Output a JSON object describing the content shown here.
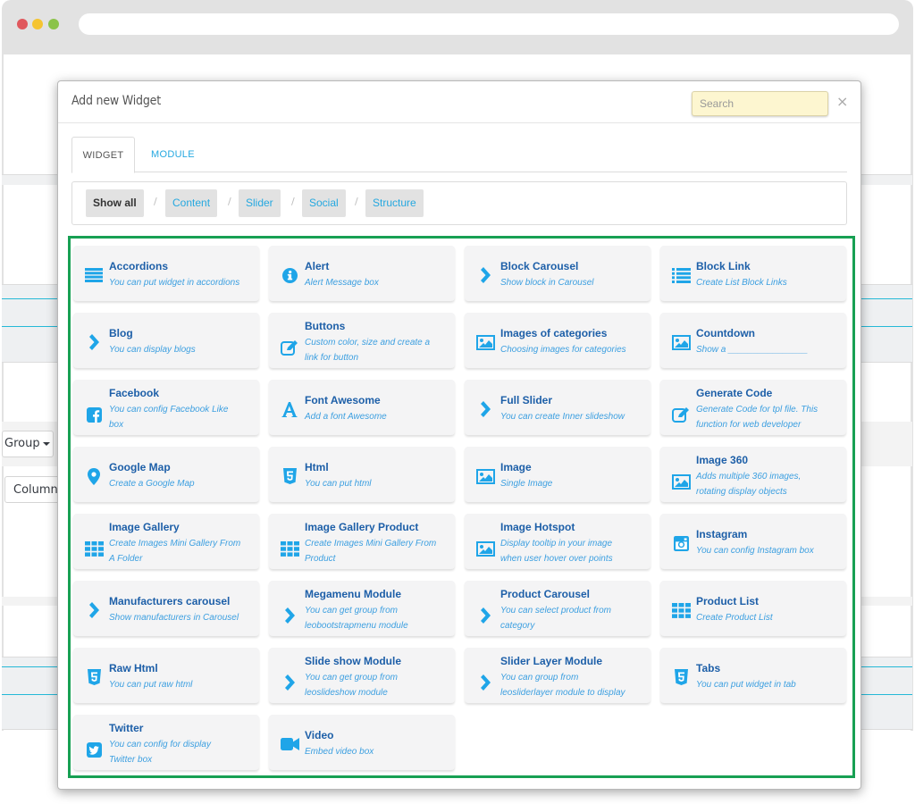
{
  "background": {
    "group_button": "Group",
    "column_button": "Column"
  },
  "modal": {
    "title": "Add new Widget",
    "search_placeholder": "Search",
    "close_label": "×"
  },
  "tabs": [
    {
      "label": "WIDGET",
      "active": true
    },
    {
      "label": "MODULE",
      "active": false
    }
  ],
  "filters": [
    {
      "label": "Show all",
      "active": true
    },
    {
      "label": "Content",
      "active": false
    },
    {
      "label": "Slider",
      "active": false
    },
    {
      "label": "Social",
      "active": false
    },
    {
      "label": "Structure",
      "active": false
    }
  ],
  "filter_separator": "/",
  "colors": {
    "accent": "#25a8e0",
    "icon": "#1fa5e8",
    "title": "#1d5fa8",
    "highlight_border": "#17a053",
    "search_bg": "#fdf6d0"
  },
  "widgets": [
    {
      "title": "Accordions",
      "desc": [
        "You can put widget in accordions"
      ],
      "icon": "bars-icon"
    },
    {
      "title": "Alert",
      "desc": [
        "Alert Message box"
      ],
      "icon": "info-circle-icon"
    },
    {
      "title": "Block Carousel",
      "desc": [
        "Show block in Carousel"
      ],
      "icon": "chevron-right-icon"
    },
    {
      "title": "Block Link",
      "desc": [
        "Create List Block Links"
      ],
      "icon": "list-icon"
    },
    {
      "title": "Blog",
      "desc": [
        "You can display blogs"
      ],
      "icon": "chevron-right-icon"
    },
    {
      "title": "Buttons",
      "desc": [
        "Custom color, size and create a",
        "link for button"
      ],
      "icon": "edit-icon"
    },
    {
      "title": "Images of categories",
      "desc": [
        "Choosing images for categories"
      ],
      "icon": "image-icon"
    },
    {
      "title": "Countdown",
      "desc": [
        "Show a ________________"
      ],
      "icon": "image-icon"
    },
    {
      "title": "Facebook",
      "desc": [
        "You can config Facebook Like",
        "box"
      ],
      "icon": "facebook-icon"
    },
    {
      "title": "Font Awesome",
      "desc": [
        "Add a font Awesome"
      ],
      "icon": "font-icon"
    },
    {
      "title": "Full Slider",
      "desc": [
        "You can create Inner slideshow"
      ],
      "icon": "chevron-right-icon"
    },
    {
      "title": "Generate Code",
      "desc": [
        "Generate Code for tpl file. This",
        "function for web developer"
      ],
      "icon": "edit-icon"
    },
    {
      "title": "Google Map",
      "desc": [
        "Create a Google Map"
      ],
      "icon": "map-marker-icon"
    },
    {
      "title": "Html",
      "desc": [
        "You can put html"
      ],
      "icon": "html5-icon"
    },
    {
      "title": "Image",
      "desc": [
        "Single Image"
      ],
      "icon": "image-icon"
    },
    {
      "title": "Image 360",
      "desc": [
        "Adds multiple 360 images,",
        "rotating display objects"
      ],
      "icon": "image-icon"
    },
    {
      "title": "Image Gallery",
      "desc": [
        "Create Images Mini Gallery From",
        "A Folder"
      ],
      "icon": "grid-icon"
    },
    {
      "title": "Image Gallery Product",
      "desc": [
        "Create Images Mini Gallery From",
        "Product"
      ],
      "icon": "grid-icon"
    },
    {
      "title": "Image Hotspot",
      "desc": [
        "Display tooltip in your image",
        "when user hover over points"
      ],
      "icon": "image-icon"
    },
    {
      "title": "Instagram",
      "desc": [
        "You can config Instagram box"
      ],
      "icon": "instagram-icon"
    },
    {
      "title": "Manufacturers carousel",
      "desc": [
        "Show manufacturers in Carousel"
      ],
      "icon": "chevron-right-icon"
    },
    {
      "title": "Megamenu Module",
      "desc": [
        "You can get group from",
        "leobootstrapmenu module"
      ],
      "icon": "chevron-right-icon"
    },
    {
      "title": "Product Carousel",
      "desc": [
        "You can select product from",
        "category"
      ],
      "icon": "chevron-right-icon"
    },
    {
      "title": "Product List",
      "desc": [
        "Create Product List"
      ],
      "icon": "grid-icon"
    },
    {
      "title": "Raw Html",
      "desc": [
        "You can put raw html"
      ],
      "icon": "html5-icon"
    },
    {
      "title": "Slide show Module",
      "desc": [
        "You can get group from",
        "leoslideshow module"
      ],
      "icon": "chevron-right-icon"
    },
    {
      "title": "Slider Layer Module",
      "desc": [
        "You can group from",
        "leosliderlayer module to display"
      ],
      "icon": "chevron-right-icon"
    },
    {
      "title": "Tabs",
      "desc": [
        "You can put widget in tab"
      ],
      "icon": "html5-icon"
    },
    {
      "title": "Twitter",
      "desc": [
        "You can config for display",
        "Twitter box"
      ],
      "icon": "twitter-icon"
    },
    {
      "title": "Video",
      "desc": [
        "Embed video box"
      ],
      "icon": "video-camera-icon"
    }
  ]
}
